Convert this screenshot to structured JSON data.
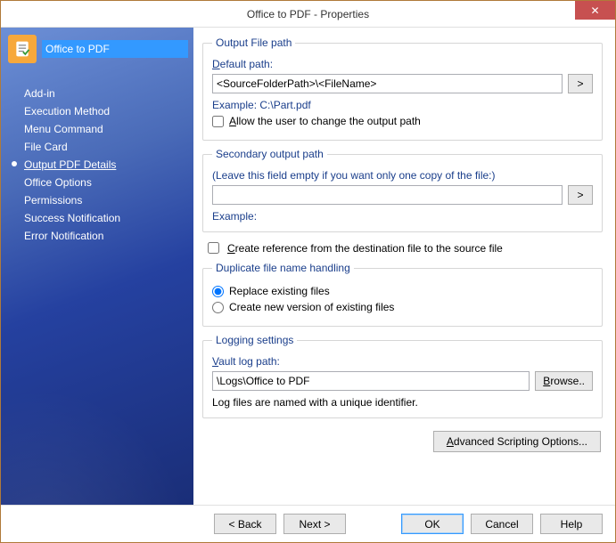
{
  "window": {
    "title": "Office to PDF - Properties"
  },
  "sidebar": {
    "title_value": "Office to PDF",
    "items": [
      {
        "label": "Add-in"
      },
      {
        "label": "Execution Method"
      },
      {
        "label": "Menu Command"
      },
      {
        "label": "File Card"
      },
      {
        "label": "Output PDF Details"
      },
      {
        "label": "Office Options"
      },
      {
        "label": "Permissions"
      },
      {
        "label": "Success Notification"
      },
      {
        "label": "Error Notification"
      }
    ],
    "active_index": 4
  },
  "output_path": {
    "legend": "Output File path",
    "default_label_pre": "D",
    "default_label_post": "efault path:",
    "default_value": "<SourceFolderPath>\\<FileName>",
    "browse_glyph": ">",
    "example_label": "Example: C:\\Part.pdf",
    "allow_label_pre": "A",
    "allow_label_post": "llow the user to change the output path",
    "allow_checked": false
  },
  "secondary_path": {
    "legend": "Secondary output path",
    "hint": "(Leave this field empty if you want only one copy of the file:)",
    "value": "",
    "browse_glyph": ">",
    "example_label": "Example:"
  },
  "create_ref": {
    "label_pre": "C",
    "label_post": "reate reference from the destination file to the source file",
    "checked": false
  },
  "duplicate": {
    "legend": "Duplicate file name handling",
    "options": [
      {
        "label": "Replace existing files",
        "checked": true
      },
      {
        "label": "Create new version of existing files",
        "checked": false
      }
    ]
  },
  "logging": {
    "legend": "Logging settings",
    "path_label_pre": "V",
    "path_label_post": "ault log path:",
    "path_value": "\\Logs\\Office to PDF",
    "browse_label_pre": "B",
    "browse_label_post": "rowse..",
    "note": "Log files are named with a unique identifier."
  },
  "advanced": {
    "label_pre": "A",
    "label_post": "dvanced Scripting Options..."
  },
  "buttons": {
    "back": "< Back",
    "next": "Next >",
    "ok": "OK",
    "cancel": "Cancel",
    "help": "Help"
  }
}
